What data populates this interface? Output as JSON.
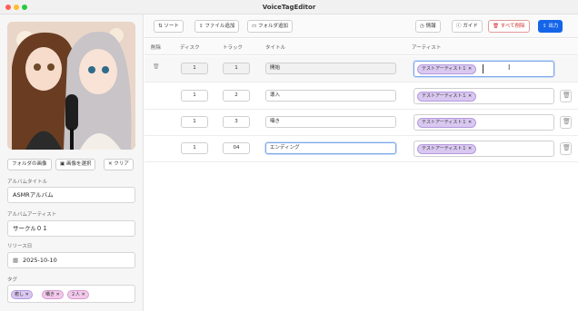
{
  "window": {
    "title": "VoiceTagEditor"
  },
  "sidebar": {
    "buttons": {
      "folder_image": "フォルダの画像",
      "select_image": "画像を選択",
      "clear": "クリア"
    },
    "album_title": {
      "label": "アルバムタイトル",
      "value": "ASMRアルバム"
    },
    "album_artist": {
      "label": "アルバムアーティスト",
      "value": "サークル０１"
    },
    "release_date": {
      "label": "リリース日",
      "value": "2025-10-10"
    },
    "tags": {
      "label": "タグ",
      "items": [
        "癒し",
        "囁き",
        "２人"
      ]
    }
  },
  "toolbar": {
    "sort": "ソート",
    "add_file": "ファイル追加",
    "add_folder": "フォルダ追加",
    "info": "情報",
    "guide": "ガイド",
    "delete_all": "すべて削除",
    "export": "出力"
  },
  "table": {
    "headers": {
      "delete": "削除",
      "disc": "ディスク",
      "track": "トラック",
      "title": "タイトル",
      "artist": "アーティスト"
    },
    "rows": [
      {
        "disc": "1",
        "track": "1",
        "title": "開始",
        "artist": "テストアーティスト１"
      },
      {
        "disc": "1",
        "track": "2",
        "title": "導入",
        "artist": "テストアーティスト１"
      },
      {
        "disc": "1",
        "track": "3",
        "title": "囁き",
        "artist": "テストアーティスト１"
      },
      {
        "disc": "1",
        "track": "04",
        "title": "エンディング",
        "artist": "テストアーティスト１"
      }
    ]
  },
  "colors": {
    "accent": "#1565e8",
    "danger": "#d32f2f",
    "chip": "#d9c8f0",
    "chip_pink": "#f1c9ea"
  }
}
